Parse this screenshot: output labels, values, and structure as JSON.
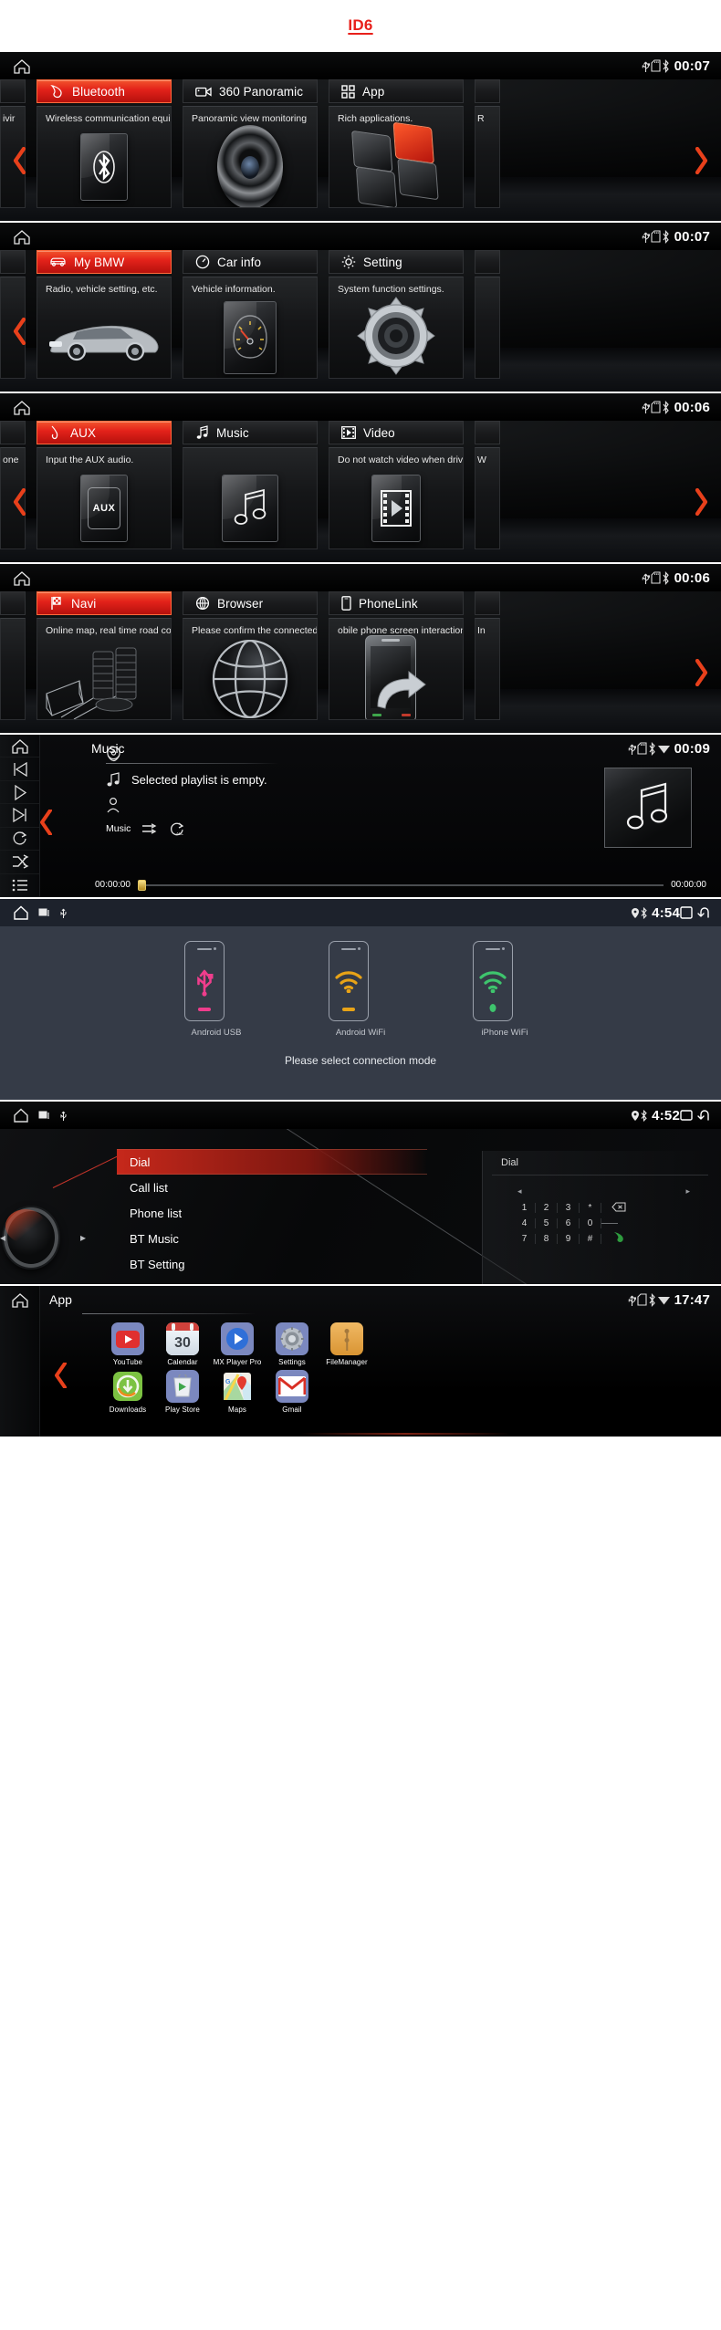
{
  "header": {
    "title": "ID6"
  },
  "screens": [
    {
      "id": "home-1",
      "clock": "00:07",
      "status_icons": [
        "usb-icon",
        "sd-card-icon",
        "bluetooth-icon"
      ],
      "home_icon": "home-icon",
      "left_arrow": "chevron-left-icon",
      "right_arrow": "chevron-right-icon",
      "edge_left_text": "ivir",
      "edge_right_text": "R",
      "cards": [
        {
          "title": "Bluetooth",
          "icon": "phone-handset-icon",
          "desc": "Wireless communication equip",
          "art": "bluetooth-logo",
          "highlighted": true
        },
        {
          "title": "360 Panoramic",
          "icon": "video-camera-icon",
          "desc": "Panoramic view monitoring",
          "art": "camera-lens",
          "highlighted": false
        },
        {
          "title": "App",
          "icon": "grid-squares-icon",
          "desc": "Rich applications.",
          "art": "app-tiles",
          "highlighted": false
        }
      ]
    },
    {
      "id": "home-2",
      "clock": "00:07",
      "status_icons": [
        "usb-icon",
        "sd-card-icon",
        "bluetooth-icon"
      ],
      "home_icon": "home-icon",
      "left_arrow": "chevron-left-icon",
      "right_arrow": "",
      "edge_left_text": "",
      "edge_right_text": "",
      "cards": [
        {
          "title": "My BMW",
          "icon": "car-icon",
          "desc": "Radio, vehicle setting, etc.",
          "art": "bmw-sedan",
          "highlighted": true
        },
        {
          "title": "Car info",
          "icon": "gauge-icon",
          "desc": "Vehicle information.",
          "art": "speedometer",
          "highlighted": false
        },
        {
          "title": "Setting",
          "icon": "gear-icon",
          "desc": "System function settings.",
          "art": "big-gear",
          "highlighted": false
        }
      ]
    },
    {
      "id": "home-3",
      "clock": "00:06",
      "status_icons": [
        "usb-icon",
        "sd-card-icon",
        "bluetooth-icon"
      ],
      "home_icon": "home-icon",
      "left_arrow": "chevron-left-icon",
      "right_arrow": "chevron-right-icon",
      "edge_left_text": "one",
      "edge_right_text": "W",
      "cards": [
        {
          "title": "AUX",
          "icon": "aux-plug-icon",
          "desc": "Input the AUX audio.",
          "art": "aux-tile",
          "highlighted": true
        },
        {
          "title": "Music",
          "icon": "music-note-icon",
          "desc": "",
          "art": "music-tile",
          "highlighted": false
        },
        {
          "title": "Video",
          "icon": "film-icon",
          "desc": "Do not watch video when drivi",
          "art": "film-tile",
          "highlighted": false
        }
      ]
    },
    {
      "id": "home-4",
      "clock": "00:06",
      "status_icons": [
        "usb-icon",
        "sd-card-icon",
        "bluetooth-icon"
      ],
      "home_icon": "home-icon",
      "left_arrow": "",
      "right_arrow": "chevron-right-icon",
      "edge_left_text": "",
      "edge_right_text": "In",
      "cards": [
        {
          "title": "Navi",
          "icon": "checkered-flag-icon",
          "desc": "Online map, real time road con",
          "art": "city-map",
          "highlighted": true
        },
        {
          "title": "Browser",
          "icon": "globe-icon",
          "desc": "Please confirm the connected",
          "art": "globe-sphere",
          "highlighted": false
        },
        {
          "title": "PhoneLink",
          "icon": "smartphone-icon",
          "desc": "obile phone screen interaction",
          "art": "phone-mirror",
          "highlighted": false
        }
      ]
    }
  ],
  "music": {
    "title": "Music",
    "clock": "00:09",
    "status_icons": [
      "usb-icon",
      "sd-card-icon",
      "bluetooth-icon",
      "wifi-icon"
    ],
    "home_icon": "home-icon",
    "rail_buttons": [
      "previous-track-icon",
      "play-icon",
      "next-track-icon",
      "repeat-icon",
      "shuffle-icon",
      "playlist-icon"
    ],
    "back_arrow": "chevron-left-icon",
    "album_icon": "disc-icon",
    "track_icon": "music-note-icon",
    "track_text": "Selected playlist is empty.",
    "artist_icon": "person-icon",
    "source_label": "Music",
    "mode_icons": [
      "sequence-play-icon",
      "repeat-all-icon"
    ],
    "time_elapsed": "00:00:00",
    "time_total": "00:00:00",
    "album_art_icon": "music-note-icon"
  },
  "connection": {
    "clock": "4:54",
    "home_icon": "home-icon",
    "left_icons": [
      "screenshot-icon",
      "usb-icon"
    ],
    "status_icons": [
      "location-pin-icon",
      "bluetooth-icon"
    ],
    "right_icons": [
      "recents-icon",
      "back-icon"
    ],
    "overlay_icons": [
      "eject-icon",
      "settings-gear-icon",
      "help-icon"
    ],
    "modes": [
      {
        "label": "Android USB",
        "icon": "usb-icon",
        "color": "#ef3d8c"
      },
      {
        "label": "Android WiFi",
        "icon": "wifi-icon",
        "color": "#e8a317"
      },
      {
        "label": "iPhone WiFi",
        "icon": "wifi-icon",
        "color": "#3ec46d"
      }
    ],
    "hint": "Please select connection mode"
  },
  "dial": {
    "clock": "4:52",
    "home_icon": "home-icon",
    "left_icons": [
      "screenshot-icon",
      "usb-icon"
    ],
    "status_icons": [
      "location-pin-icon",
      "bluetooth-icon"
    ],
    "right_icons": [
      "recents-icon",
      "back-icon"
    ],
    "menu": [
      {
        "label": "Dial",
        "selected": true
      },
      {
        "label": "Call list",
        "selected": false
      },
      {
        "label": "Phone list",
        "selected": false
      },
      {
        "label": "BT Music",
        "selected": false
      },
      {
        "label": "BT Setting",
        "selected": false
      }
    ],
    "panel_title": "Dial",
    "keypad_rows": [
      [
        "1",
        "2",
        "3",
        "*"
      ],
      [
        "4",
        "5",
        "6",
        "0"
      ],
      [
        "7",
        "8",
        "9",
        "#"
      ]
    ],
    "keypad_side": [
      "backspace-icon",
      "divider",
      "call-icon"
    ],
    "arrow_left": "caret-left-icon",
    "arrow_right": "caret-right-icon",
    "knob_icon": "rotary-knob-icon"
  },
  "app_drawer": {
    "title": "App",
    "clock": "17:47",
    "status_icons": [
      "usb-icon",
      "sd-card-icon",
      "bluetooth-icon",
      "wifi-icon"
    ],
    "home_icon": "home-icon",
    "back_arrow": "chevron-left-icon",
    "apps": [
      {
        "label": "YouTube",
        "icon": "youtube-icon",
        "bg": "#7b88bf"
      },
      {
        "label": "Calendar",
        "icon": "calendar-icon",
        "bg": "#ffffff",
        "day": "30"
      },
      {
        "label": "MX Player Pro",
        "icon": "mx-player-icon",
        "bg": "#7b88bf"
      },
      {
        "label": "Settings",
        "icon": "settings-gear-icon",
        "bg": "#7b88bf"
      },
      {
        "label": "FileManager",
        "icon": "folder-envelope-icon",
        "bg": "#e8ab51"
      },
      {
        "label": "Downloads",
        "icon": "download-icon",
        "bg": "#77c043"
      },
      {
        "label": "Play Store",
        "icon": "play-store-icon",
        "bg": "#7b88bf"
      },
      {
        "label": "Maps",
        "icon": "maps-pin-icon",
        "bg": "#7b88bf"
      },
      {
        "label": "Gmail",
        "icon": "gmail-envelope-icon",
        "bg": "#7b88bf"
      }
    ]
  }
}
